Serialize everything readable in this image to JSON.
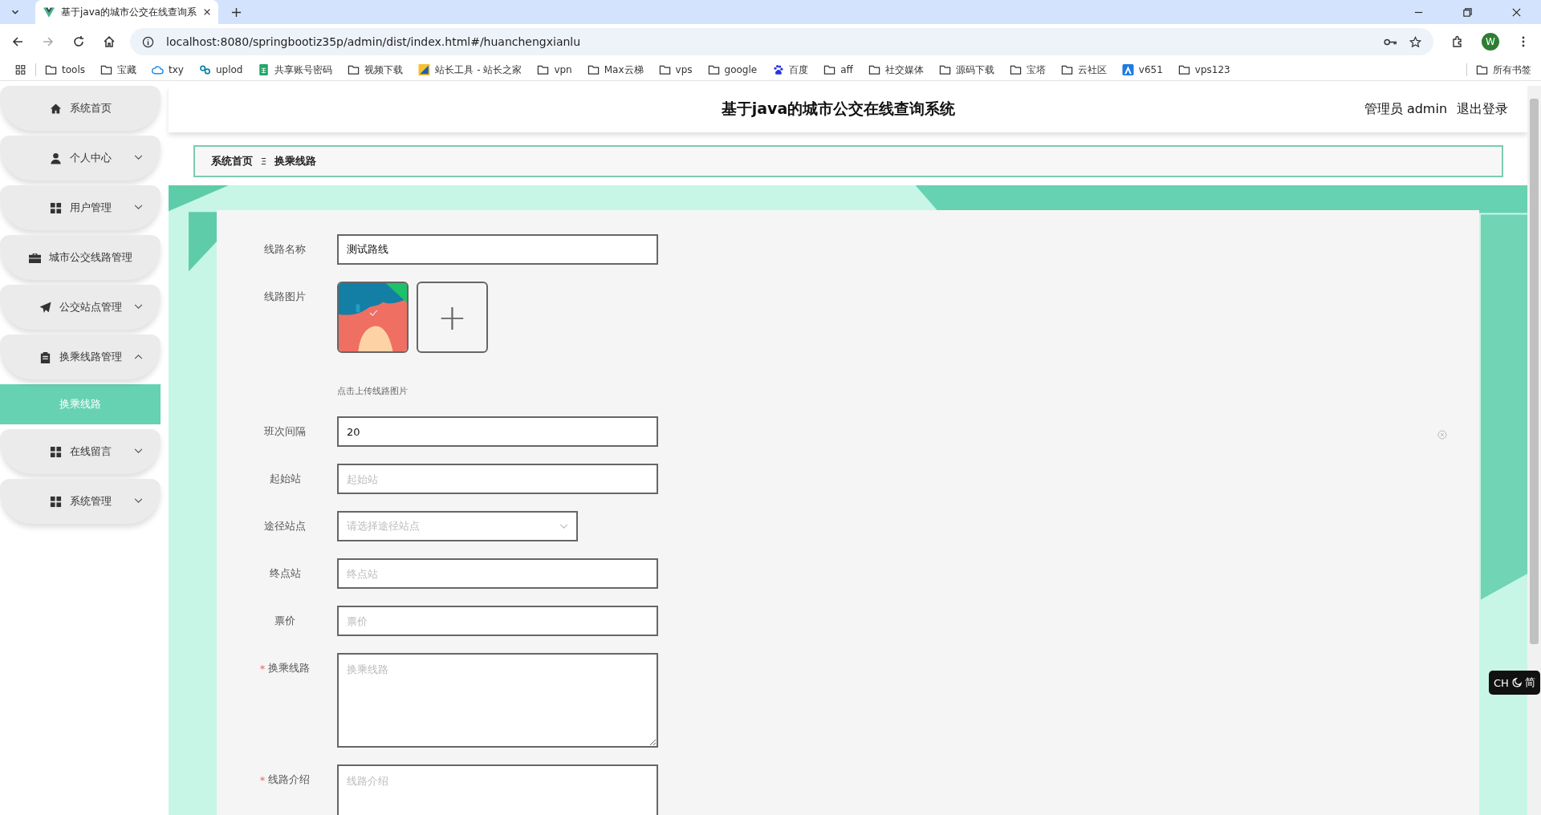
{
  "browser": {
    "tab_title": "基于java的城市公交在线查询系",
    "url": "localhost:8080/springbootiz35p/admin/dist/index.html#/huanchengxianlu",
    "profile": "W",
    "bookmarks": [
      {
        "label": "tools",
        "kind": "folder"
      },
      {
        "label": "宝藏",
        "kind": "folder"
      },
      {
        "label": "txy",
        "kind": "site"
      },
      {
        "label": "uplod",
        "kind": "site"
      },
      {
        "label": "共享账号密码",
        "kind": "site"
      },
      {
        "label": "视频下载",
        "kind": "folder"
      },
      {
        "label": "站长工具 - 站长之家",
        "kind": "site"
      },
      {
        "label": "vpn",
        "kind": "folder"
      },
      {
        "label": "Max云梯",
        "kind": "folder"
      },
      {
        "label": "vps",
        "kind": "folder"
      },
      {
        "label": "google",
        "kind": "folder"
      },
      {
        "label": "百度",
        "kind": "site"
      },
      {
        "label": "aff",
        "kind": "folder"
      },
      {
        "label": "社交媒体",
        "kind": "folder"
      },
      {
        "label": "源码下载",
        "kind": "folder"
      },
      {
        "label": "宝塔",
        "kind": "folder"
      },
      {
        "label": "云社区",
        "kind": "folder"
      },
      {
        "label": "v651",
        "kind": "site"
      },
      {
        "label": "vps123",
        "kind": "folder"
      }
    ],
    "all_bookmarks": "所有书签"
  },
  "app": {
    "title": "基于java的城市公交在线查询系统",
    "user": "管理员 admin",
    "logout": "退出登录",
    "sidebar": [
      {
        "label": "系统首页"
      },
      {
        "label": "个人中心",
        "expanded": false
      },
      {
        "label": "用户管理",
        "expanded": false
      },
      {
        "label": "城市公交线路管理"
      },
      {
        "label": "公交站点管理",
        "expanded": false
      },
      {
        "label": "换乘线路管理",
        "expanded": true,
        "children": [
          {
            "label": "换乘线路",
            "selected": true
          }
        ]
      },
      {
        "label": "在线留言",
        "expanded": false
      },
      {
        "label": "系统管理",
        "expanded": false
      }
    ],
    "breadcrumb": [
      "系统首页",
      "换乘线路"
    ],
    "form": [
      {
        "kind": "text",
        "label": "线路名称",
        "value": "测试路线"
      },
      {
        "kind": "upload",
        "label": "线路图片",
        "hint": "点击上传线路图片",
        "add": "+"
      },
      {
        "kind": "text",
        "label": "班次间隔",
        "value": "20"
      },
      {
        "kind": "text",
        "label": "起始站",
        "placeholder": "起始站"
      },
      {
        "kind": "select",
        "label": "途径站点",
        "placeholder": "请选择途径站点"
      },
      {
        "kind": "text",
        "label": "终点站",
        "placeholder": "终点站"
      },
      {
        "kind": "text",
        "label": "票价",
        "placeholder": "票价"
      },
      {
        "kind": "textarea",
        "label": "换乘线路",
        "placeholder": "换乘线路",
        "required_mark": "*"
      },
      {
        "kind": "textarea",
        "label": "线路介绍",
        "placeholder": "线路介绍",
        "required_mark": "*"
      }
    ]
  },
  "ime": {
    "lang": "CH",
    "mode": "简"
  }
}
